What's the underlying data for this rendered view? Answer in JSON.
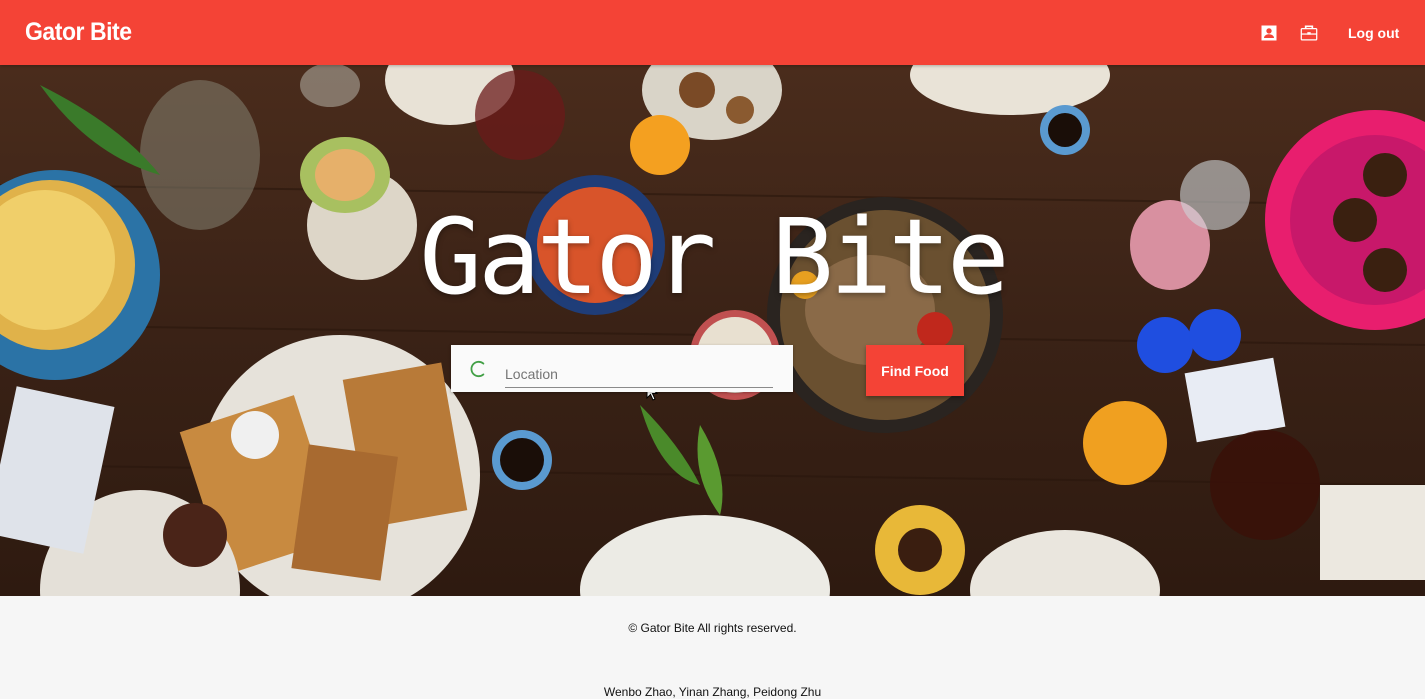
{
  "navbar": {
    "brand": "Gator Bite",
    "icons": [
      "account-box-icon",
      "briefcase-icon"
    ],
    "logout_label": "Log out",
    "color": "#f44336"
  },
  "hero": {
    "title": "Gator Bite",
    "search": {
      "placeholder": "Location",
      "value": ""
    },
    "find_button": "Find Food"
  },
  "footer": {
    "copyright": "© Gator Bite All rights reserved.",
    "authors": "Wenbo Zhao, Yinan Zhang, Peidong Zhu"
  }
}
